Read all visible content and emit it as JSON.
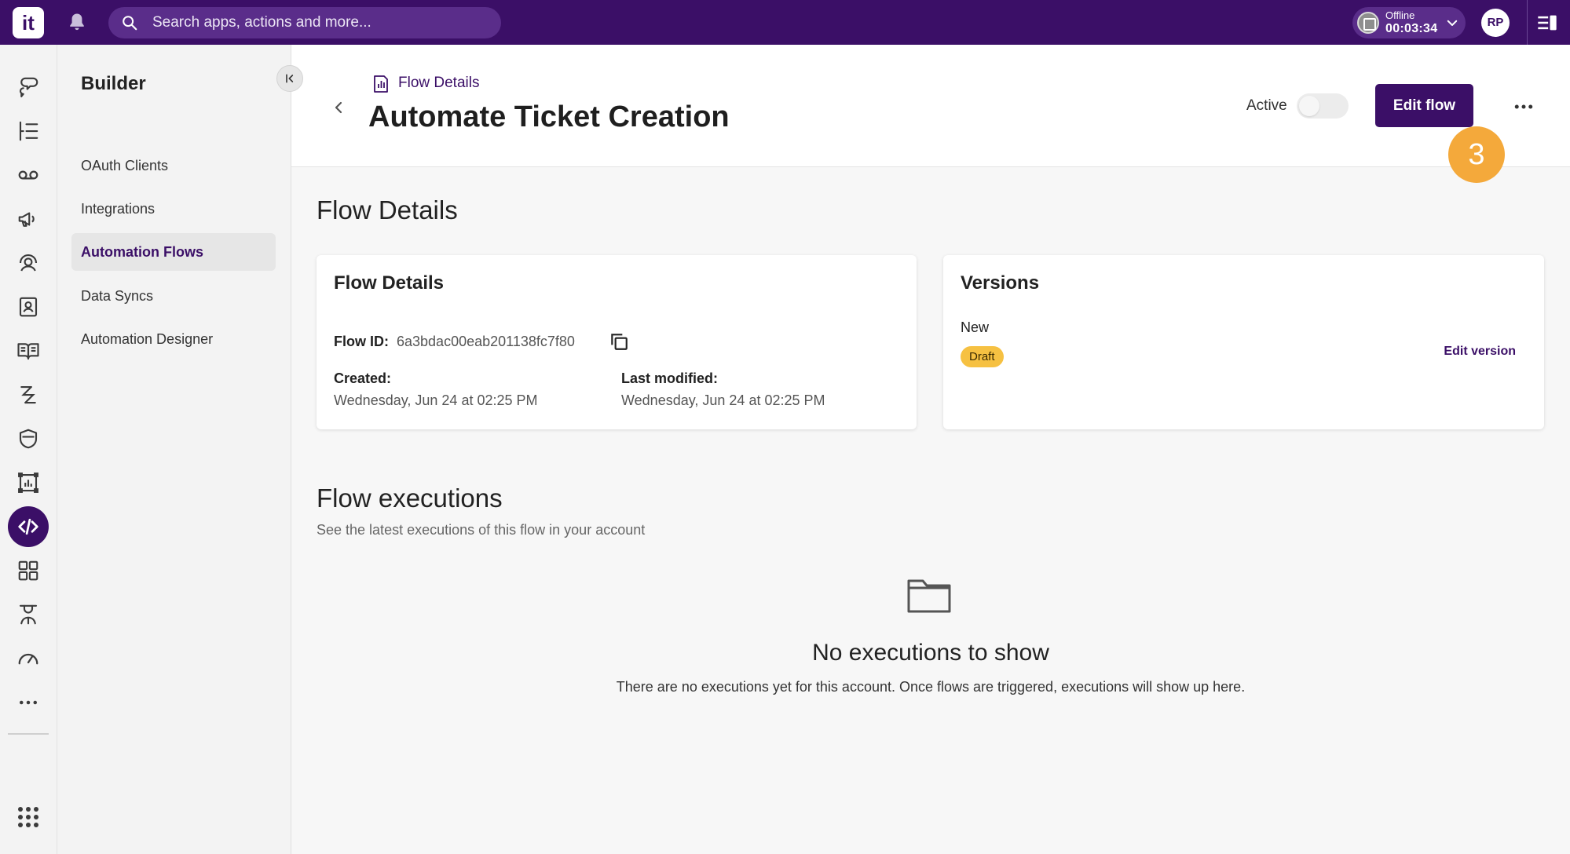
{
  "topbar": {
    "logo_text": "it",
    "search_placeholder": "Search apps, actions and more...",
    "status_label": "Offline",
    "status_timer": "00:03:34",
    "avatar_initials": "RP"
  },
  "rail": {
    "icons": [
      "chat-bubbles-icon",
      "list-icon",
      "voicemail-icon",
      "megaphone-icon",
      "agent-icon",
      "contact-book-icon",
      "knowledge-book-icon",
      "workflow-icon",
      "shield-icon",
      "dashboard-icon",
      "code-icon",
      "apps-grid-icon",
      "user-admin-icon",
      "speedometer-icon",
      "more-horizontal-icon",
      "app-launcher-icon"
    ],
    "active": "code-icon"
  },
  "nav": {
    "title": "Builder",
    "items": [
      {
        "label": "OAuth Clients",
        "active": false
      },
      {
        "label": "Integrations",
        "active": false
      },
      {
        "label": "Automation Flows",
        "active": true
      },
      {
        "label": "Data Syncs",
        "active": false
      },
      {
        "label": "Automation Designer",
        "active": false
      }
    ]
  },
  "header": {
    "breadcrumb": "Flow Details",
    "title": "Automate Ticket Creation",
    "active_label": "Active",
    "active_on": false,
    "edit_flow_label": "Edit flow",
    "step_badge": "3"
  },
  "details_section": {
    "title": "Flow Details",
    "card_title": "Flow Details",
    "flow_id_label": "Flow ID:",
    "flow_id_value": "6a3bdac00eab201138fc7f80",
    "created_label": "Created:",
    "created_value": "Wednesday, Jun 24 at 02:25 PM",
    "modified_label": "Last modified:",
    "modified_value": "Wednesday, Jun 24 at 02:25 PM"
  },
  "versions": {
    "title": "Versions",
    "version_name": "New",
    "status_badge": "Draft",
    "edit_version_label": "Edit version"
  },
  "executions": {
    "title": "Flow executions",
    "subtitle": "See the latest executions of this flow in your account",
    "empty_title": "No executions to show",
    "empty_text": "There are no executions yet for this account. Once flows are triggered, executions will show up here."
  },
  "colors": {
    "brand": "#3b0f67",
    "accent_badge": "#f4a93b",
    "draft": "#f6c142"
  }
}
